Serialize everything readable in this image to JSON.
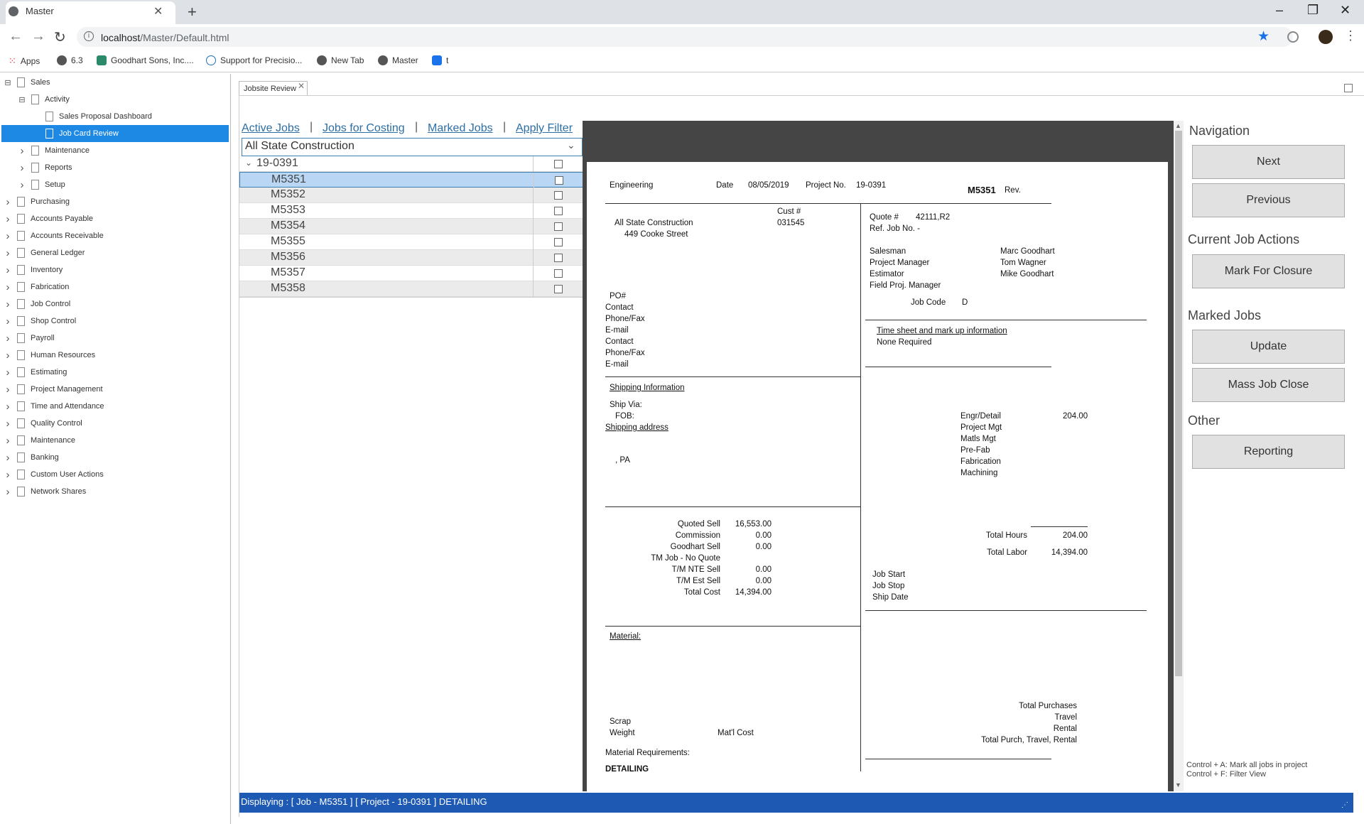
{
  "browser": {
    "tab_title": "Master",
    "url_host": "localhost",
    "url_path": "/Master/Default.html",
    "bookmarks": [
      "Apps",
      "6.3",
      "Goodhart Sons, Inc....",
      "Support for Precisio...",
      "New Tab",
      "Master",
      "t"
    ]
  },
  "sidebar": {
    "items": [
      {
        "label": "Sales",
        "expander": "minus"
      },
      {
        "label": "Activity",
        "expander": "minus"
      },
      {
        "label": "Sales Proposal Dashboard",
        "expander": ""
      },
      {
        "label": "Job Card Review",
        "expander": "",
        "selected": true
      },
      {
        "label": "Maintenance",
        "expander": "arrow"
      },
      {
        "label": "Reports",
        "expander": "arrow"
      },
      {
        "label": "Setup",
        "expander": "arrow"
      },
      {
        "label": "Purchasing",
        "expander": "arrow"
      },
      {
        "label": "Accounts Payable",
        "expander": "arrow"
      },
      {
        "label": "Accounts Receivable",
        "expander": "arrow"
      },
      {
        "label": "General Ledger",
        "expander": "arrow"
      },
      {
        "label": "Inventory",
        "expander": "arrow"
      },
      {
        "label": "Fabrication",
        "expander": "arrow"
      },
      {
        "label": "Job Control",
        "expander": "arrow"
      },
      {
        "label": "Shop Control",
        "expander": "arrow"
      },
      {
        "label": "Payroll",
        "expander": "arrow"
      },
      {
        "label": "Human Resources",
        "expander": "arrow"
      },
      {
        "label": "Estimating",
        "expander": "arrow"
      },
      {
        "label": "Project Management",
        "expander": "arrow"
      },
      {
        "label": "Time and Attendance",
        "expander": "arrow"
      },
      {
        "label": "Quality Control",
        "expander": "arrow"
      },
      {
        "label": "Maintenance",
        "expander": "arrow"
      },
      {
        "label": "Banking",
        "expander": "arrow"
      },
      {
        "label": "Custom User Actions",
        "expander": "arrow"
      },
      {
        "label": "Network Shares",
        "expander": "arrow"
      }
    ]
  },
  "document_tab": "Jobsite Review",
  "filters": {
    "active_jobs": "Active Jobs",
    "jobs_for_costing": "Jobs for Costing",
    "marked_jobs": "Marked Jobs",
    "apply_filter": "Apply Filter",
    "separator": "|",
    "customer": "All State Construction"
  },
  "job_list": {
    "group": "19-0391",
    "jobs": [
      "M5351",
      "M5352",
      "M5353",
      "M5354",
      "M5355",
      "M5356",
      "M5357",
      "M5358"
    ],
    "selected": "M5351"
  },
  "report": {
    "department": "Engineering",
    "date_label": "Date",
    "date": "08/05/2019",
    "project_label": "Project No.",
    "project_no": "19-0391",
    "job_no": "M5351",
    "rev_label": "Rev.",
    "cust_label": "Cust #",
    "cust_no": "031545",
    "customer_name": "All State Construction",
    "customer_street": "449 Cooke Street",
    "quote_label": "Quote #",
    "quote_no": "42111,R2",
    "ref_job_label": "Ref. Job No. -",
    "salesman_label": "Salesman",
    "salesman": "Marc Goodhart",
    "pm_label": "Project Manager",
    "pm": "Tom Wagner",
    "estimator_label": "Estimator",
    "estimator": "Mike Goodhart",
    "field_pm_label": "Field Proj. Manager",
    "job_code_label": "Job Code",
    "job_code": "D",
    "po_label": "PO#",
    "contact1": "Contact",
    "phone1": "Phone/Fax",
    "email1": "E-mail",
    "contact2": "Contact",
    "phone2": "Phone/Fax",
    "email2": "E-mail",
    "timesheet_label": "Time sheet and mark up information",
    "timesheet_value": "None Required",
    "shipping_info": "Shipping Information",
    "ship_via": "Ship Via:",
    "fob": "FOB:",
    "shipping_address": "Shipping address",
    "ship_state": ", PA",
    "engr_detail": "Engr/Detail",
    "engr_detail_hours": "204.00",
    "project_mgt": "Project Mgt",
    "matls_mgt": "Matls Mgt",
    "pre_fab": "Pre-Fab",
    "fabrication": "Fabrication",
    "machining": "Machining",
    "quoted_sell_label": "Quoted Sell",
    "quoted_sell": "16,553.00",
    "commission_label": "Commission",
    "commission": "0.00",
    "goodhart_sell_label": "Goodhart Sell",
    "goodhart_sell": "0.00",
    "tm_job": "TM Job - No Quote",
    "tm_nte_label": "T/M NTE Sell",
    "tm_nte": "0.00",
    "tm_est_label": "T/M Est Sell",
    "tm_est": "0.00",
    "total_cost_label": "Total Cost",
    "total_cost": "14,394.00",
    "total_hours_label": "Total Hours",
    "total_hours": "204.00",
    "total_labor_label": "Total Labor",
    "total_labor": "14,394.00",
    "job_start": "Job Start",
    "job_stop": "Job Stop",
    "ship_date": "Ship Date",
    "material_label": "Material:",
    "total_purchases": "Total Purchases",
    "travel": "Travel",
    "rental": "Rental",
    "total_ptr": "Total Purch, Travel, Rental",
    "scrap": "Scrap",
    "weight": "Weight",
    "matl_cost": "Mat'l Cost",
    "material_requirements": "Material Requirements:",
    "detailing": "DETAILING"
  },
  "actions": {
    "navigation": "Navigation",
    "next": "Next",
    "previous": "Previous",
    "current_job_actions": "Current Job Actions",
    "mark_for_closure": "Mark For Closure",
    "marked_jobs": "Marked Jobs",
    "update": "Update",
    "mass_job_close": "Mass Job Close",
    "other": "Other",
    "reporting": "Reporting",
    "hint1": "Control + A: Mark all jobs in project",
    "hint2": "Control + F: Filter View"
  },
  "status": "Displaying : [ Job - M5351 ] [ Project - 19-0391 ] DETAILING"
}
